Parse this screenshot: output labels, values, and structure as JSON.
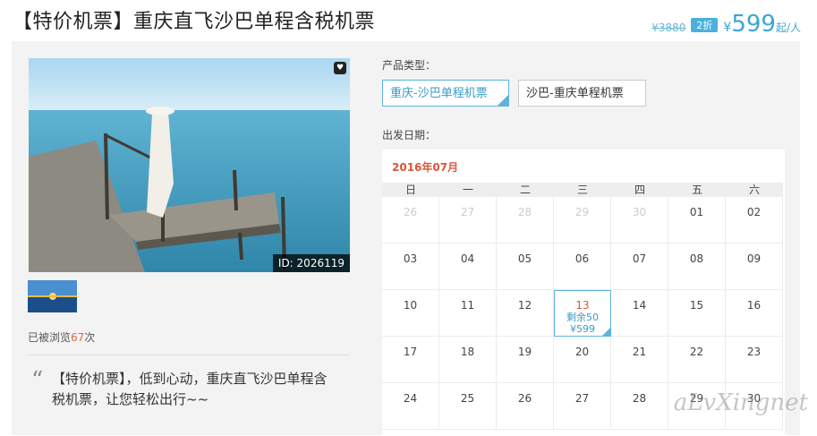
{
  "header": {
    "title": "【特价机票】重庆直飞沙巴单程含税机票",
    "original_price": "¥3880",
    "discount": "2折",
    "currency": "¥",
    "price": "599",
    "unit": "起/人"
  },
  "gallery": {
    "image_id": "ID: 2026119",
    "views_prefix": "已被浏览",
    "views_count": "67",
    "views_suffix": "次"
  },
  "description": "【特价机票】，低到心动，重庆直飞沙巴单程含税机票，让您轻松出行~~",
  "product_type": {
    "label": "产品类型：",
    "options": [
      "重庆-沙巴单程机票",
      "沙巴-重庆单程机票"
    ],
    "selected_index": 0
  },
  "date": {
    "label": "出发日期：",
    "month": "2016年07月",
    "weekdays": [
      "日",
      "一",
      "二",
      "三",
      "四",
      "五",
      "六"
    ],
    "weeks": [
      [
        "26",
        "27",
        "28",
        "29",
        "30",
        "01",
        "02"
      ],
      [
        "03",
        "04",
        "05",
        "06",
        "07",
        "08",
        "09"
      ],
      [
        "10",
        "11",
        "12",
        "13",
        "14",
        "15",
        "16"
      ],
      [
        "17",
        "18",
        "19",
        "20",
        "21",
        "22",
        "23"
      ],
      [
        "24",
        "25",
        "26",
        "27",
        "28",
        "29",
        "30"
      ]
    ],
    "selected": {
      "day": "13",
      "remaining": "剩余50",
      "price": "¥599"
    }
  },
  "watermark": "aLvXingnet",
  "colors": {
    "accent": "#3aa6d8",
    "highlight": "#d9573b"
  }
}
